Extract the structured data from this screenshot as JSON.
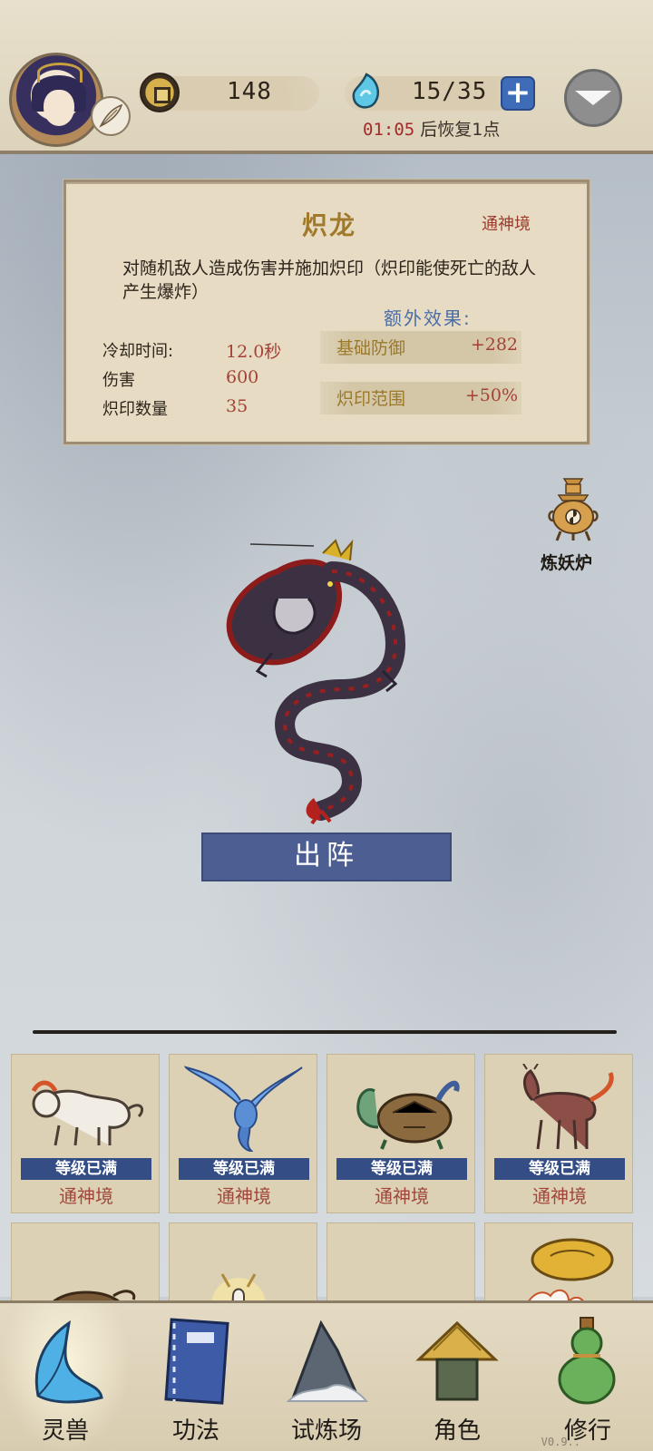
{
  "header": {
    "coins": "148",
    "spirit": "15/35",
    "recover_time": "01:05",
    "recover_text": "后恢复1点"
  },
  "skill": {
    "name": "炽龙",
    "rank": "通神境",
    "description": "对随机敌人造成伤害并施加炽印（炽印能使死亡的敌人产生爆炸）",
    "extra_title": "额外效果:",
    "stats": [
      {
        "label": "冷却时间:",
        "value": "12.0秒"
      },
      {
        "label": "伤害",
        "value": "600"
      },
      {
        "label": "炽印数量",
        "value": "35"
      }
    ],
    "bonuses": [
      {
        "label": "基础防御",
        "value": "+282"
      },
      {
        "label": "炽印范围",
        "value": "+50%"
      }
    ]
  },
  "furnace_label": "炼妖炉",
  "deploy_label": "出阵",
  "beasts": [
    {
      "tag": "等级已满",
      "realm": "通神境",
      "icon": "white-tiger-icon"
    },
    {
      "tag": "等级已满",
      "realm": "通神境",
      "icon": "blue-phoenix-icon"
    },
    {
      "tag": "等级已满",
      "realm": "通神境",
      "icon": "black-tortoise-icon"
    },
    {
      "tag": "等级已满",
      "realm": "通神境",
      "icon": "qilin-icon"
    }
  ],
  "nav": [
    {
      "label": "灵兽",
      "icon": "feather-icon"
    },
    {
      "label": "功法",
      "icon": "book-icon"
    },
    {
      "label": "试炼场",
      "icon": "mountain-icon"
    },
    {
      "label": "角色",
      "icon": "straw-hat-icon"
    },
    {
      "label": "修行",
      "icon": "gourd-icon"
    }
  ],
  "version": "V0.9.."
}
